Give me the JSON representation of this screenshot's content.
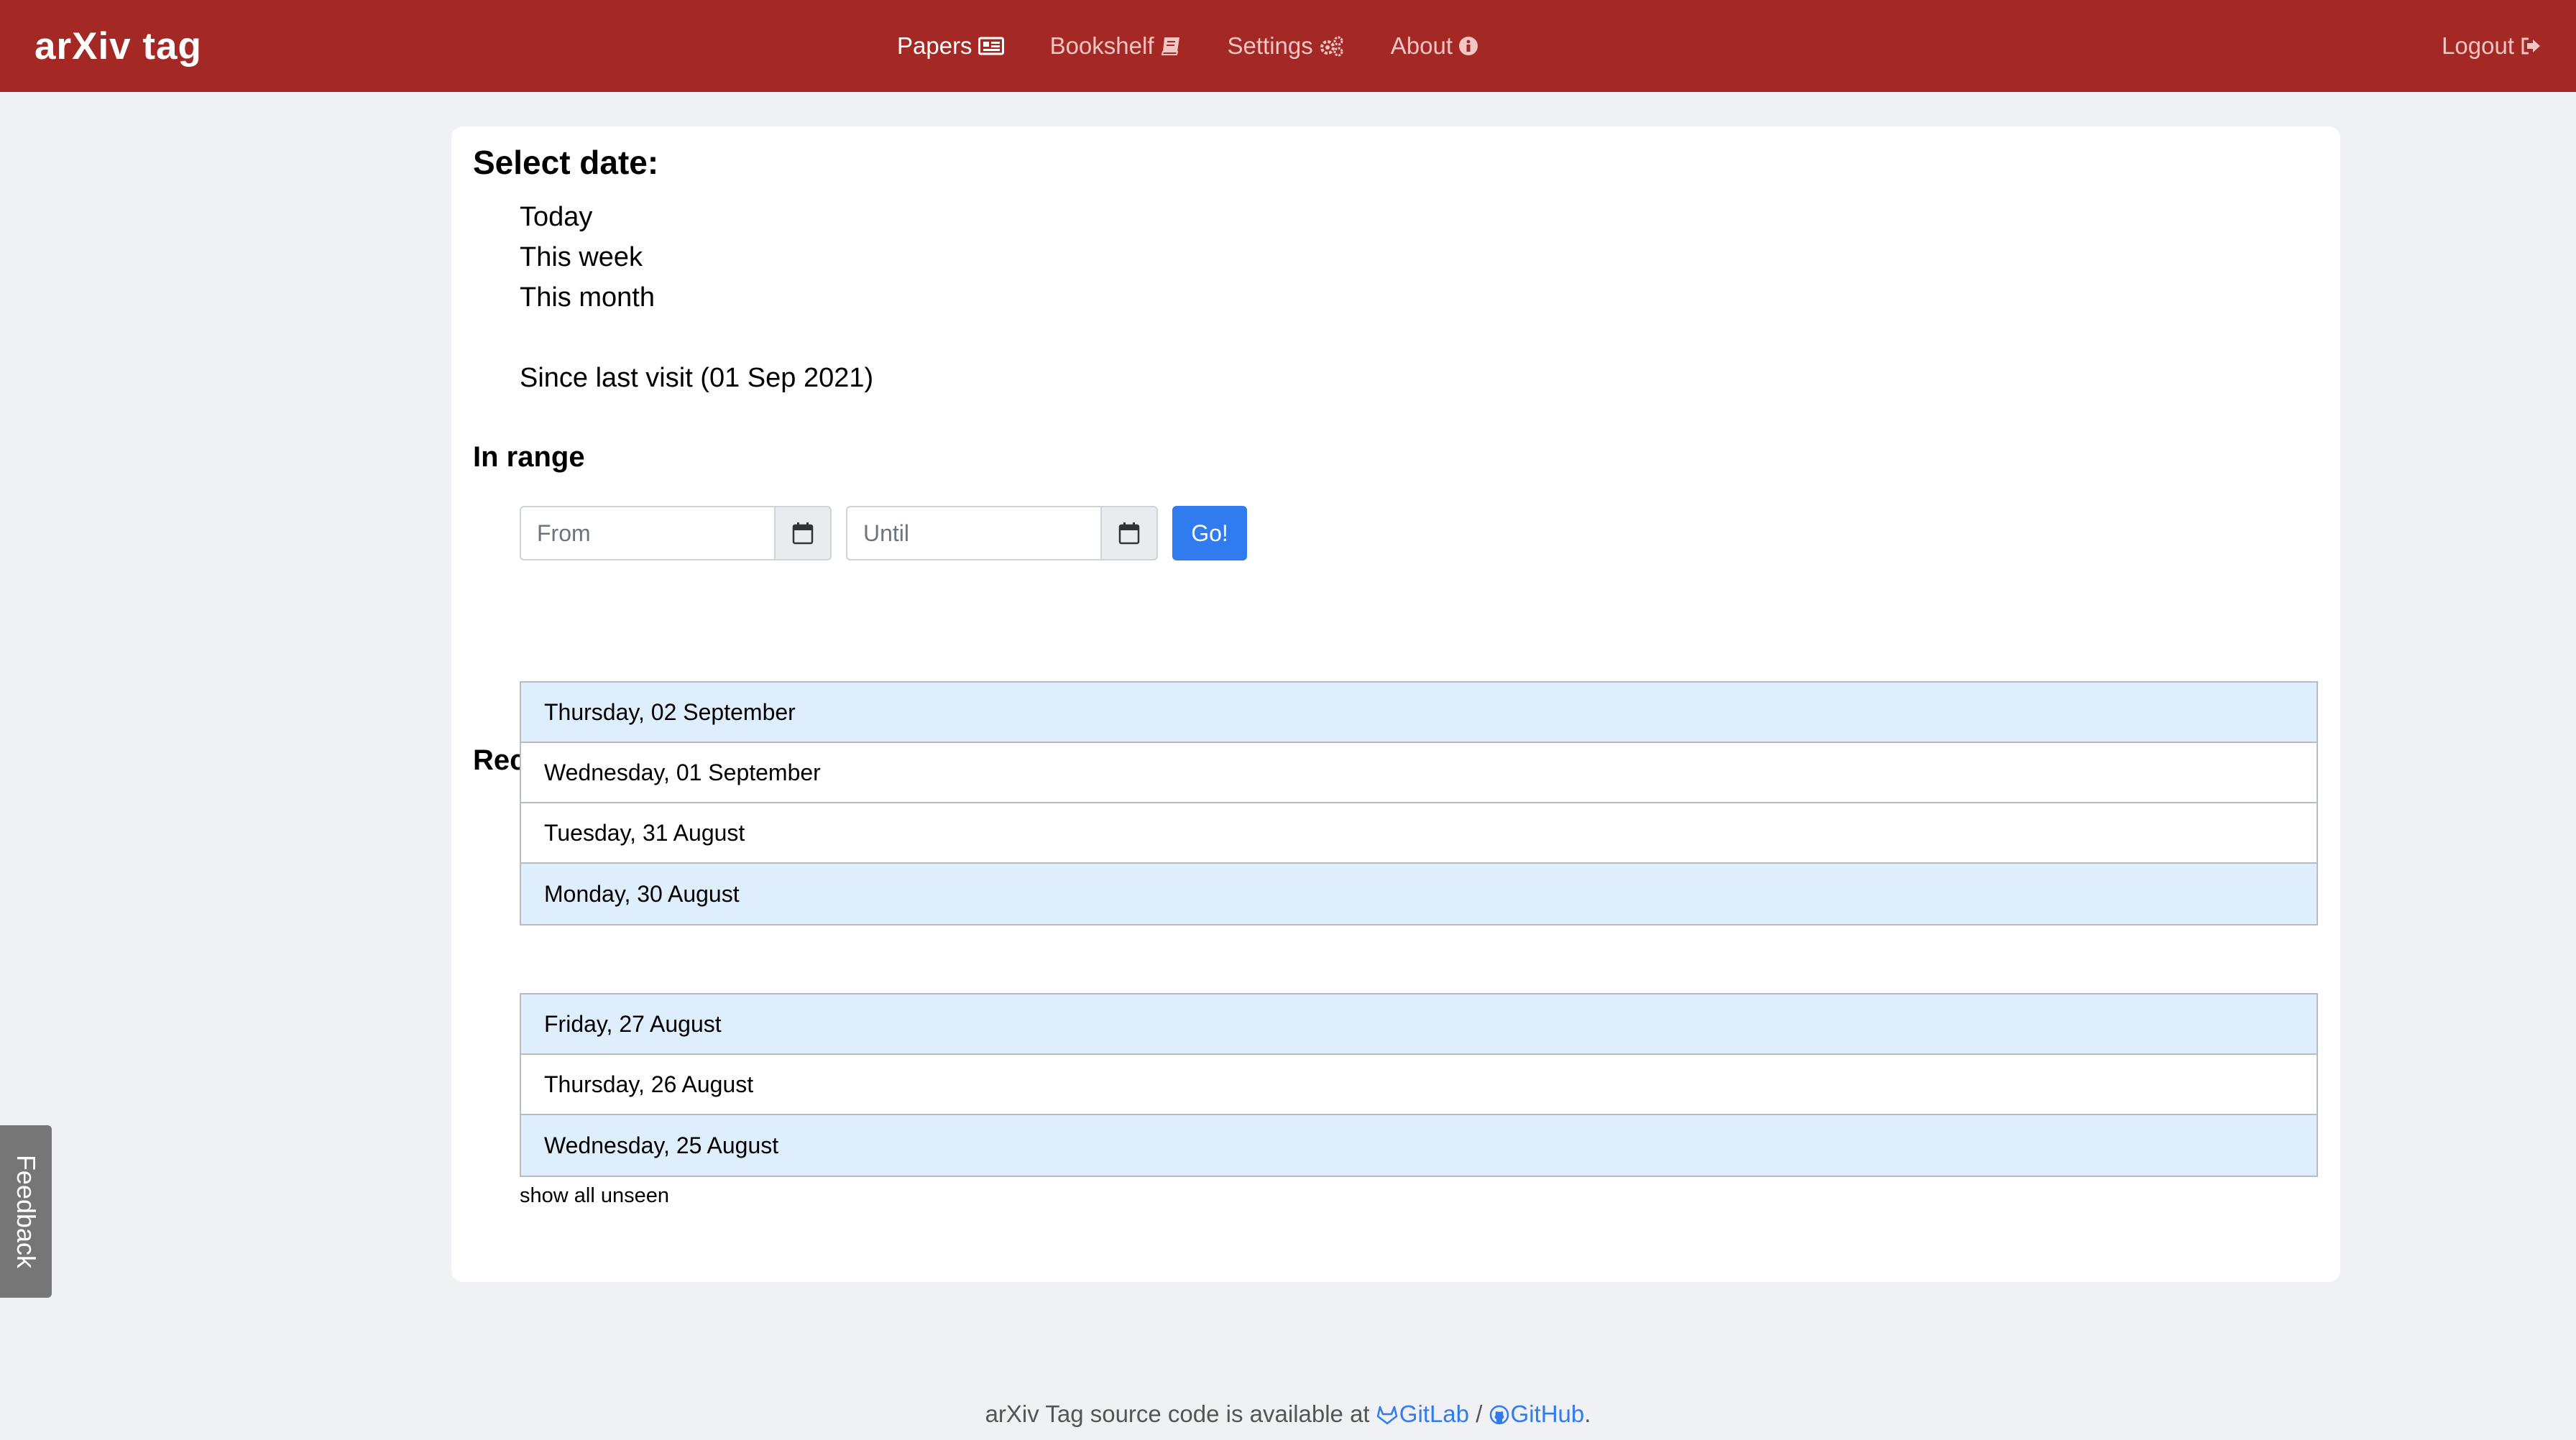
{
  "brand": "arXiv tag",
  "nav": {
    "papers": "Papers",
    "bookshelf": "Bookshelf",
    "settings": "Settings",
    "about": "About",
    "logout": "Logout"
  },
  "select_date": {
    "heading": "Select date:",
    "today": "Today",
    "this_week": "This week",
    "this_month": "This month",
    "since_last_visit": "Since last visit (01 Sep 2021)"
  },
  "range": {
    "heading": "In range",
    "from_placeholder": "From",
    "until_placeholder": "Until",
    "go_label": "Go!"
  },
  "recent": {
    "heading": "Recent submissions",
    "week1": [
      {
        "label": "Thursday, 02 September",
        "highlighted": true
      },
      {
        "label": "Wednesday, 01 September",
        "highlighted": false
      },
      {
        "label": "Tuesday, 31 August",
        "highlighted": false
      },
      {
        "label": "Monday, 30 August",
        "highlighted": true
      }
    ],
    "week2": [
      {
        "label": "Friday, 27 August",
        "highlighted": true
      },
      {
        "label": "Thursday, 26 August",
        "highlighted": false
      },
      {
        "label": "Wednesday, 25 August",
        "highlighted": true
      }
    ],
    "show_all_unseen": "show all unseen"
  },
  "footer": {
    "text": "arXiv Tag source code is available at",
    "gitlab": "GitLab",
    "separator": "/",
    "github": "GitHub",
    "end": "."
  },
  "feedback": "Feedback",
  "colors": {
    "navbar": "#a42925",
    "highlight_row": "#dfeefc",
    "accent": "#2f7bef"
  }
}
